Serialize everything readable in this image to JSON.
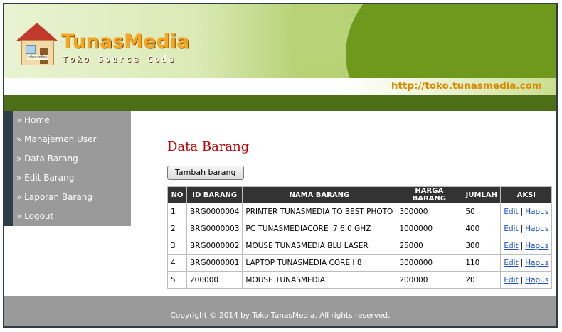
{
  "header": {
    "brand": "TunasMedia",
    "tagline": "Toko Source Code",
    "house_sign": "toko online",
    "url": "http://toko.tunasmedia.com"
  },
  "sidebar": {
    "items": [
      {
        "label": "» Home"
      },
      {
        "label": "» Manajemen User"
      },
      {
        "label": "» Data Barang"
      },
      {
        "label": "» Edit Barang"
      },
      {
        "label": "» Laporan Barang"
      },
      {
        "label": "» Logout"
      }
    ]
  },
  "main": {
    "title": "Data Barang",
    "add_button": "Tambah barang",
    "table": {
      "columns": [
        "NO",
        "ID BARANG",
        "NAMA BARANG",
        "HARGA BARANG",
        "JUMLAH",
        "AKSI"
      ],
      "edit_label": "Edit",
      "separator": "|",
      "delete_label": "Hapus",
      "rows": [
        {
          "no": "1",
          "id": "BRG0000004",
          "nama": "PRINTER TUNASMEDIA TO BEST PHOTO",
          "harga": "300000",
          "jumlah": "50"
        },
        {
          "no": "2",
          "id": "BRG0000003",
          "nama": "PC TUNASMEDIACORE I7 6.0 GHZ",
          "harga": "1000000",
          "jumlah": "400"
        },
        {
          "no": "3",
          "id": "BRG0000002",
          "nama": "MOUSE TUNASMEDIA BLU LASER",
          "harga": "25000",
          "jumlah": "300"
        },
        {
          "no": "4",
          "id": "BRG0000001",
          "nama": "LAPTOP TUNASMEDIA CORE I 8",
          "harga": "3000000",
          "jumlah": "110"
        },
        {
          "no": "5",
          "id": "200000",
          "nama": "MOUSE TUNASMEDIA",
          "harga": "200000",
          "jumlah": "20"
        }
      ]
    }
  },
  "footer": {
    "copyright": "Copyright © 2014 by Toko TunasMedia. All rights reserved."
  },
  "colors": {
    "title": "#c00000",
    "url": "#d98a00",
    "link": "#1a4fd6",
    "sidebar": "#9a9a9a",
    "header_green": "#6e991c"
  }
}
